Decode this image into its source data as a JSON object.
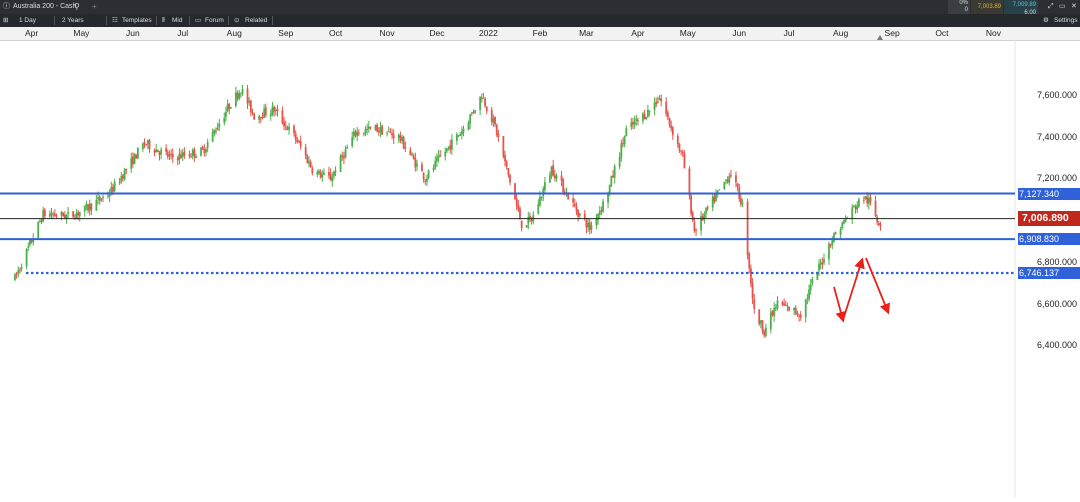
{
  "app": {
    "instrument": "Australia 200 - Cash",
    "new_tab": "+",
    "change": "0%",
    "change_sub": "0",
    "bid": "7,003.89",
    "offer": "7,009.89",
    "spread": "6.00",
    "settings_label": "Settings"
  },
  "toolbar": {
    "interval": "1 Day",
    "range": "2 Years",
    "templates": "Templates",
    "mid": "Mid",
    "forum": "Forum",
    "related": "Related"
  },
  "colors": {
    "up": "#49b049",
    "down": "#e5534b",
    "level_line": "#2f62d8",
    "current_line": "#222222",
    "current_badge": "#c0281c",
    "arrow": "#e8211c"
  },
  "chart_data": {
    "type": "candlestick",
    "x_ticks": [
      "Apr",
      "May",
      "Jun",
      "Jul",
      "Aug",
      "Sep",
      "Oct",
      "Nov",
      "Dec",
      "2022",
      "Feb",
      "Mar",
      "Apr",
      "May",
      "Jun",
      "Jul",
      "Aug",
      "Sep",
      "Oct",
      "Nov"
    ],
    "y_ticks": [
      "7,600.000",
      "7,400.000",
      "7,200.000",
      "6,800.000",
      "6,600.000",
      "6,400.000"
    ],
    "ylim": [
      6400,
      7650
    ],
    "levels": [
      {
        "label": "7,127.340",
        "value": 7127.34,
        "style": "solid"
      },
      {
        "label": "7,006.890",
        "value": 7006.89,
        "style": "current"
      },
      {
        "label": "6,908.830",
        "value": 6908.83,
        "style": "solid"
      },
      {
        "label": "6,746.137",
        "value": 6746.137,
        "style": "dotted"
      }
    ],
    "anchors": [
      [
        "2021-03-29",
        6720
      ],
      [
        "2021-04-15",
        7030
      ],
      [
        "2021-05-01",
        7020
      ],
      [
        "2021-05-10",
        7050
      ],
      [
        "2021-05-25",
        7130
      ],
      [
        "2021-06-15",
        7370
      ],
      [
        "2021-07-01",
        7300
      ],
      [
        "2021-07-20",
        7330
      ],
      [
        "2021-08-05",
        7550
      ],
      [
        "2021-08-12",
        7630
      ],
      [
        "2021-08-20",
        7500
      ],
      [
        "2021-09-01",
        7530
      ],
      [
        "2021-09-15",
        7380
      ],
      [
        "2021-09-25",
        7230
      ],
      [
        "2021-10-05",
        7200
      ],
      [
        "2021-10-20",
        7420
      ],
      [
        "2021-11-01",
        7440
      ],
      [
        "2021-11-15",
        7400
      ],
      [
        "2021-12-01",
        7200
      ],
      [
        "2021-12-10",
        7300
      ],
      [
        "2021-12-24",
        7440
      ],
      [
        "2022-01-04",
        7600
      ],
      [
        "2022-01-12",
        7450
      ],
      [
        "2022-01-28",
        6980
      ],
      [
        "2022-02-03",
        7000
      ],
      [
        "2022-02-15",
        7250
      ],
      [
        "2022-03-01",
        7060
      ],
      [
        "2022-03-10",
        6960
      ],
      [
        "2022-03-20",
        7110
      ],
      [
        "2022-04-01",
        7430
      ],
      [
        "2022-04-14",
        7520
      ],
      [
        "2022-04-21",
        7590
      ],
      [
        "2022-05-05",
        7300
      ],
      [
        "2022-05-12",
        6950
      ],
      [
        "2022-05-20",
        7050
      ],
      [
        "2022-06-03",
        7230
      ],
      [
        "2022-06-10",
        7070
      ],
      [
        "2022-06-17",
        6560
      ],
      [
        "2022-06-23",
        6470
      ],
      [
        "2022-07-01",
        6600
      ],
      [
        "2022-07-15",
        6550
      ],
      [
        "2022-07-22",
        6700
      ],
      [
        "2022-08-02",
        6900
      ],
      [
        "2022-08-15",
        7050
      ],
      [
        "2022-08-22",
        7110
      ],
      [
        "2022-08-26",
        7080
      ],
      [
        "2022-08-30",
        7000
      ],
      [
        "2022-09-01",
        6990
      ]
    ]
  }
}
